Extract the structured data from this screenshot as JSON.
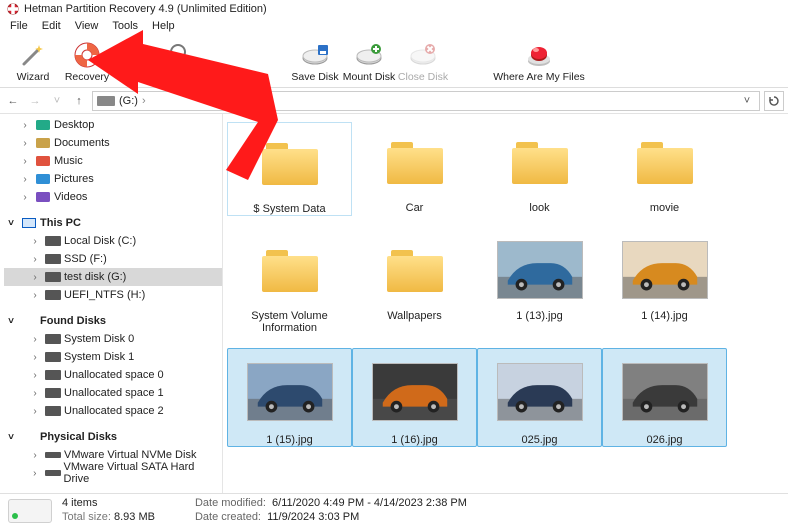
{
  "title": "Hetman Partition Recovery 4.9 (Unlimited Edition)",
  "menu": {
    "file": "File",
    "edit": "Edit",
    "view": "View",
    "tools": "Tools",
    "help": "Help"
  },
  "toolbar": {
    "wizard": "Wizard",
    "recovery": "Recovery",
    "savedisk": "Save Disk",
    "mountdisk": "Mount Disk",
    "closedisk": "Close Disk",
    "whereare": "Where Are My Files"
  },
  "address": {
    "path_suffix": "(G:)",
    "sep": "›"
  },
  "tree": {
    "quick": [
      {
        "label": "Desktop",
        "icon": "desktop"
      },
      {
        "label": "Documents",
        "icon": "doc"
      },
      {
        "label": "Music",
        "icon": "music"
      },
      {
        "label": "Pictures",
        "icon": "pic"
      },
      {
        "label": "Videos",
        "icon": "vid"
      }
    ],
    "thispc_label": "This PC",
    "thispc": [
      {
        "label": "Local Disk (C:)"
      },
      {
        "label": "SSD (F:)"
      },
      {
        "label": "test disk (G:)",
        "selected": true
      },
      {
        "label": "UEFI_NTFS (H:)"
      }
    ],
    "found_label": "Found Disks",
    "found": [
      {
        "label": "System Disk 0"
      },
      {
        "label": "System Disk 1"
      },
      {
        "label": "Unallocated space 0"
      },
      {
        "label": "Unallocated space 1"
      },
      {
        "label": "Unallocated space 2"
      }
    ],
    "physical_label": "Physical Disks",
    "physical": [
      {
        "label": "VMware Virtual NVMe Disk"
      },
      {
        "label": "VMware Virtual SATA Hard Drive"
      }
    ]
  },
  "items_row1": [
    {
      "type": "folder",
      "label": "$ System Data",
      "highlight": true
    },
    {
      "type": "folder",
      "label": "Car"
    },
    {
      "type": "folder",
      "label": "look"
    },
    {
      "type": "folder",
      "label": "movie"
    }
  ],
  "items_row2": [
    {
      "type": "folder",
      "label": "System Volume Information"
    },
    {
      "type": "folder",
      "label": "Wallpapers"
    },
    {
      "type": "photo",
      "label": "1 (13).jpg",
      "c1": "#2f6a9e",
      "c2": "#9db9cc"
    },
    {
      "type": "photo",
      "label": "1 (14).jpg",
      "c1": "#d78a1f",
      "c2": "#e8d8bf"
    }
  ],
  "items_row3": [
    {
      "type": "photo",
      "label": "1 (15).jpg",
      "selected": true,
      "c1": "#2d4a6e",
      "c2": "#8aa6c4"
    },
    {
      "type": "photo",
      "label": "1 (16).jpg",
      "selected": true,
      "c1": "#d06a1a",
      "c2": "#3a3a3a"
    },
    {
      "type": "photo",
      "label": "025.jpg",
      "selected": true,
      "c1": "#2a3a55",
      "c2": "#c7d2e0"
    },
    {
      "type": "photo",
      "label": "026.jpg",
      "selected": true,
      "c1": "#3a3a3a",
      "c2": "#808080"
    }
  ],
  "status": {
    "count": "4 items",
    "size_label": "Total size:",
    "size_val": "8.93 MB",
    "mod_label": "Date modified:",
    "mod_val": "6/11/2020 4:49 PM - 4/14/2023 2:38 PM",
    "cre_label": "Date created:",
    "cre_val": "11/9/2024 3:03 PM"
  }
}
